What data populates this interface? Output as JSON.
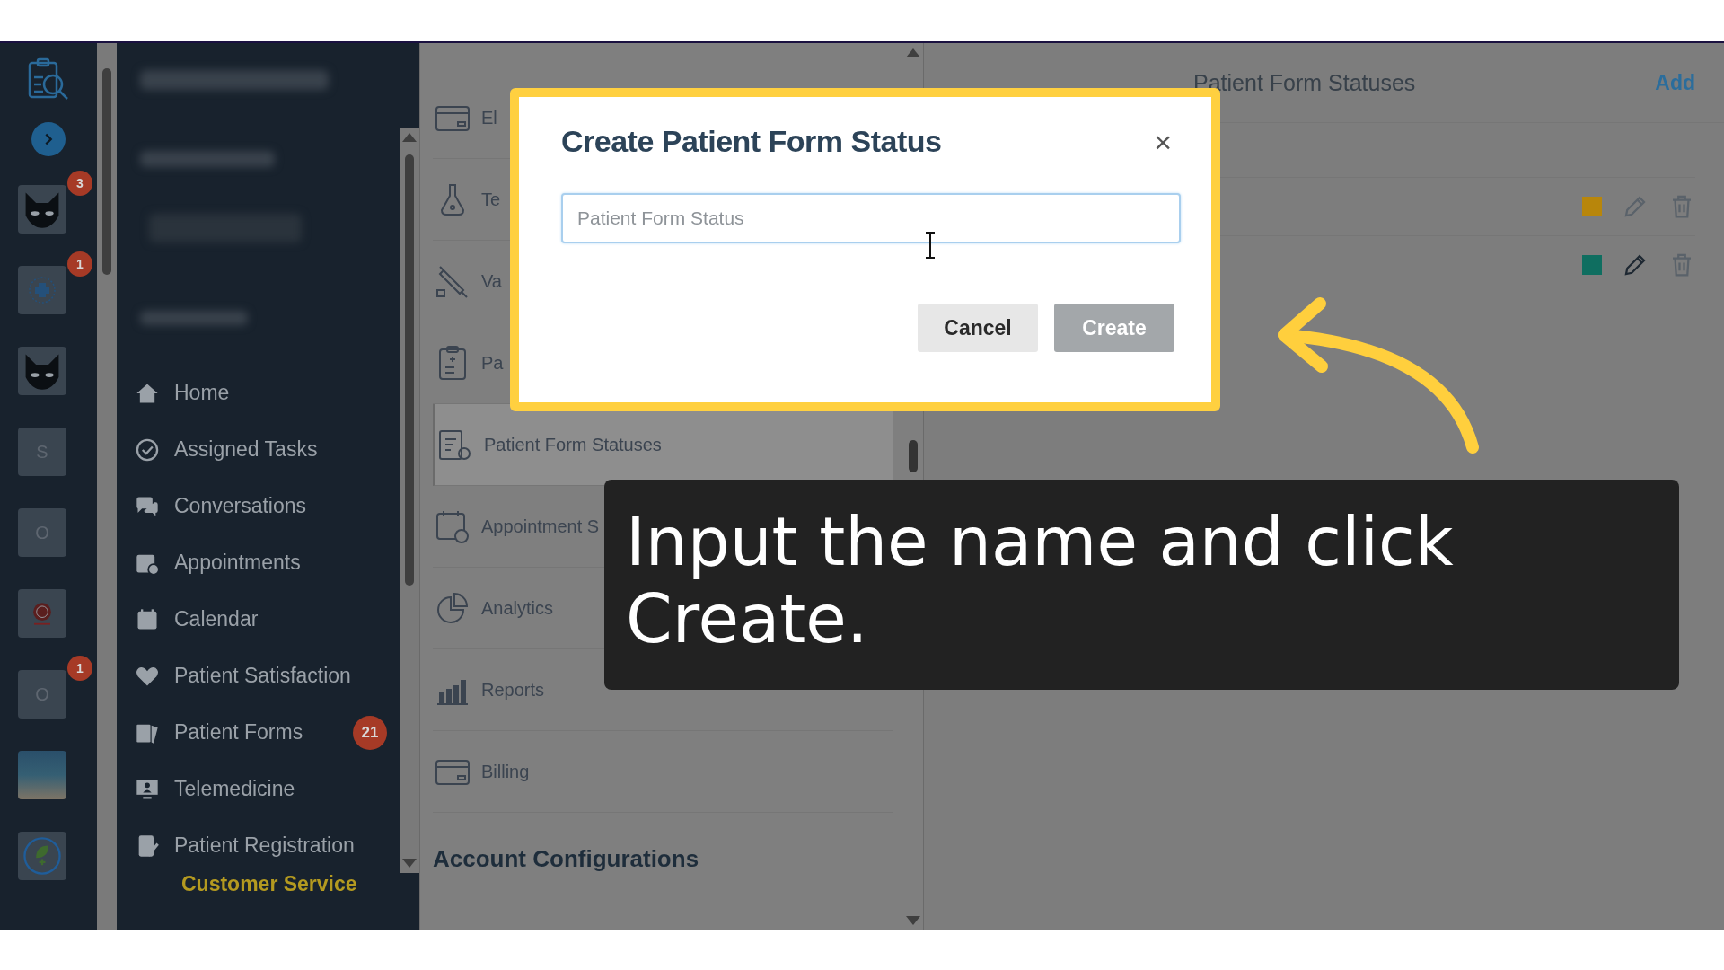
{
  "rail": {
    "tiles": [
      {
        "kind": "cat",
        "badge": "3"
      },
      {
        "kind": "emblem",
        "badge": "1"
      },
      {
        "kind": "cat"
      },
      {
        "kind": "letter",
        "letter": "S"
      },
      {
        "kind": "letter",
        "letter": "O"
      },
      {
        "kind": "seal"
      },
      {
        "kind": "letter",
        "letter": "O",
        "badge": "1"
      },
      {
        "kind": "photo"
      },
      {
        "kind": "leaf"
      }
    ]
  },
  "sidebar": {
    "items": [
      {
        "label": "Home"
      },
      {
        "label": "Assigned Tasks"
      },
      {
        "label": "Conversations"
      },
      {
        "label": "Appointments"
      },
      {
        "label": "Calendar"
      },
      {
        "label": "Patient Satisfaction"
      },
      {
        "label": "Patient Forms",
        "badge": "21"
      },
      {
        "label": "Telemedicine"
      },
      {
        "label": "Patient Registration"
      }
    ],
    "section": "Customer Service"
  },
  "settings_list": {
    "items": [
      {
        "label": "El",
        "selected": false
      },
      {
        "label": "Te",
        "selected": false
      },
      {
        "label": "Va",
        "selected": false
      },
      {
        "label": "Pa",
        "selected": false
      },
      {
        "label": "Patient Form Statuses",
        "selected": true
      },
      {
        "label": "Appointment S",
        "selected": false
      },
      {
        "label": "Analytics",
        "selected": false
      },
      {
        "label": "Reports",
        "selected": false
      },
      {
        "label": "Billing",
        "selected": false
      }
    ],
    "heading": "Account Configurations"
  },
  "panel": {
    "title": "Patient Form Statuses",
    "add": "Add",
    "rows": [
      {
        "color": "#b8860b"
      },
      {
        "color": "#0f6e60"
      }
    ]
  },
  "dialog": {
    "title": "Create Patient Form Status",
    "close": "×",
    "field": {
      "placeholder": "Patient Form Status"
    },
    "buttons": [
      {
        "label": "Cancel",
        "disabled": false
      },
      {
        "label": "Create",
        "disabled": true
      }
    ]
  },
  "caption": {
    "text": "Input the name and click Create."
  }
}
